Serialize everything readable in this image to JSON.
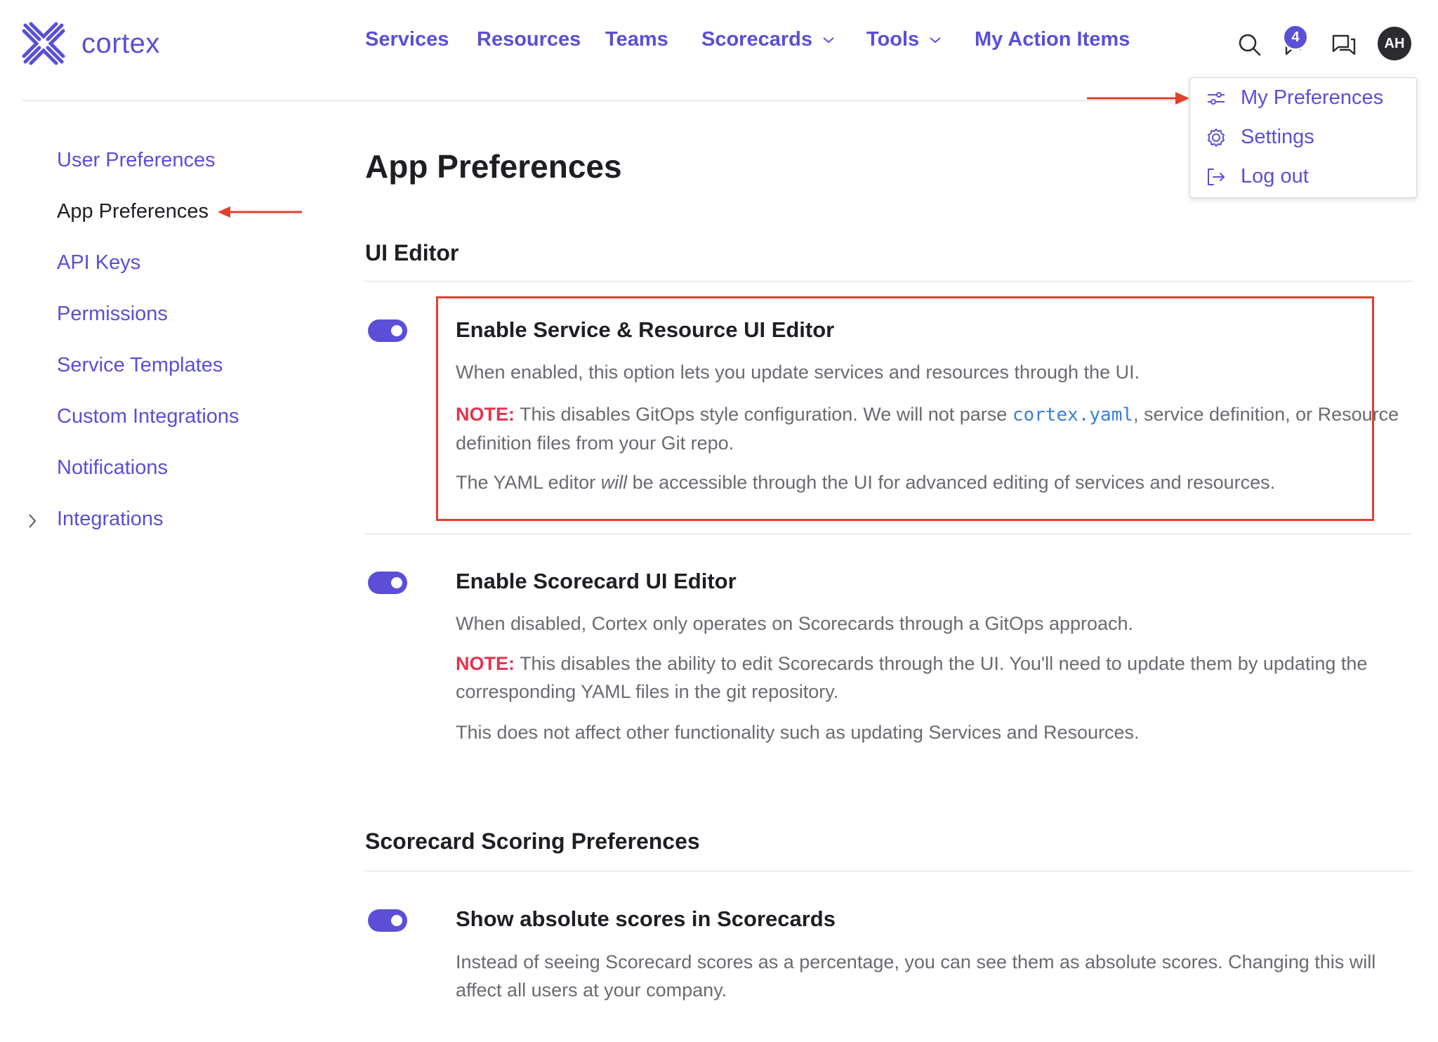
{
  "header": {
    "logo_text": "cortex",
    "nav": [
      {
        "label": "Services"
      },
      {
        "label": "Resources"
      },
      {
        "label": "Teams"
      },
      {
        "label": "Scorecards"
      },
      {
        "label": "Tools"
      },
      {
        "label": "My Action Items"
      }
    ],
    "notification_count": "4",
    "avatar_initials": "AH",
    "icons": [
      "search-icon",
      "notification-icon",
      "chat-icon"
    ]
  },
  "dropdown": {
    "items": [
      {
        "label": "My Preferences",
        "icon": "sliders-icon"
      },
      {
        "label": "Settings",
        "icon": "gear-icon"
      },
      {
        "label": "Log out",
        "icon": "logout-icon"
      }
    ]
  },
  "sidebar": {
    "items": [
      {
        "label": "User Preferences"
      },
      {
        "label": "App Preferences"
      },
      {
        "label": "API Keys"
      },
      {
        "label": "Permissions"
      },
      {
        "label": "Service Templates"
      },
      {
        "label": "Custom Integrations"
      },
      {
        "label": "Notifications"
      },
      {
        "label": "Integrations"
      }
    ],
    "active": "App Preferences"
  },
  "main": {
    "title": "App Preferences",
    "sections": [
      {
        "title": "UI Editor",
        "settings": [
          {
            "title": "Enable Service & Resource UI Editor",
            "enabled": true,
            "description": "When enabled, this option lets you update services and resources through the UI.",
            "note_label": "NOTE:",
            "note_pre": " This disables GitOps style configuration. We will not parse ",
            "note_code": "cortex.yaml",
            "note_post": ", service definition, or Resource definition files from your Git repo.",
            "extra_pre": "The YAML editor ",
            "extra_em": "will",
            "extra_post": " be accessible through the UI for advanced editing of services and resources."
          },
          {
            "title": "Enable Scorecard UI Editor",
            "enabled": true,
            "description": "When disabled, Cortex only operates on Scorecards through a GitOps approach.",
            "note_label": "NOTE:",
            "note_text": " This disables the ability to edit Scorecards through the UI. You'll need to update them by updating the corresponding YAML files in the git repository.",
            "extra": "This does not affect other functionality such as updating Services and Resources."
          }
        ]
      },
      {
        "title": "Scorecard Scoring Preferences",
        "settings": [
          {
            "title": "Show absolute scores in Scorecards",
            "enabled": true,
            "description": "Instead of seeing Scorecard scores as a percentage, you can see them as absolute scores. Changing this will affect all users at your company."
          }
        ]
      }
    ]
  },
  "colors": {
    "accent": "#5a4fd6",
    "note": "#e0344f",
    "annotation": "#e0402e",
    "code": "#3b7ddd"
  }
}
